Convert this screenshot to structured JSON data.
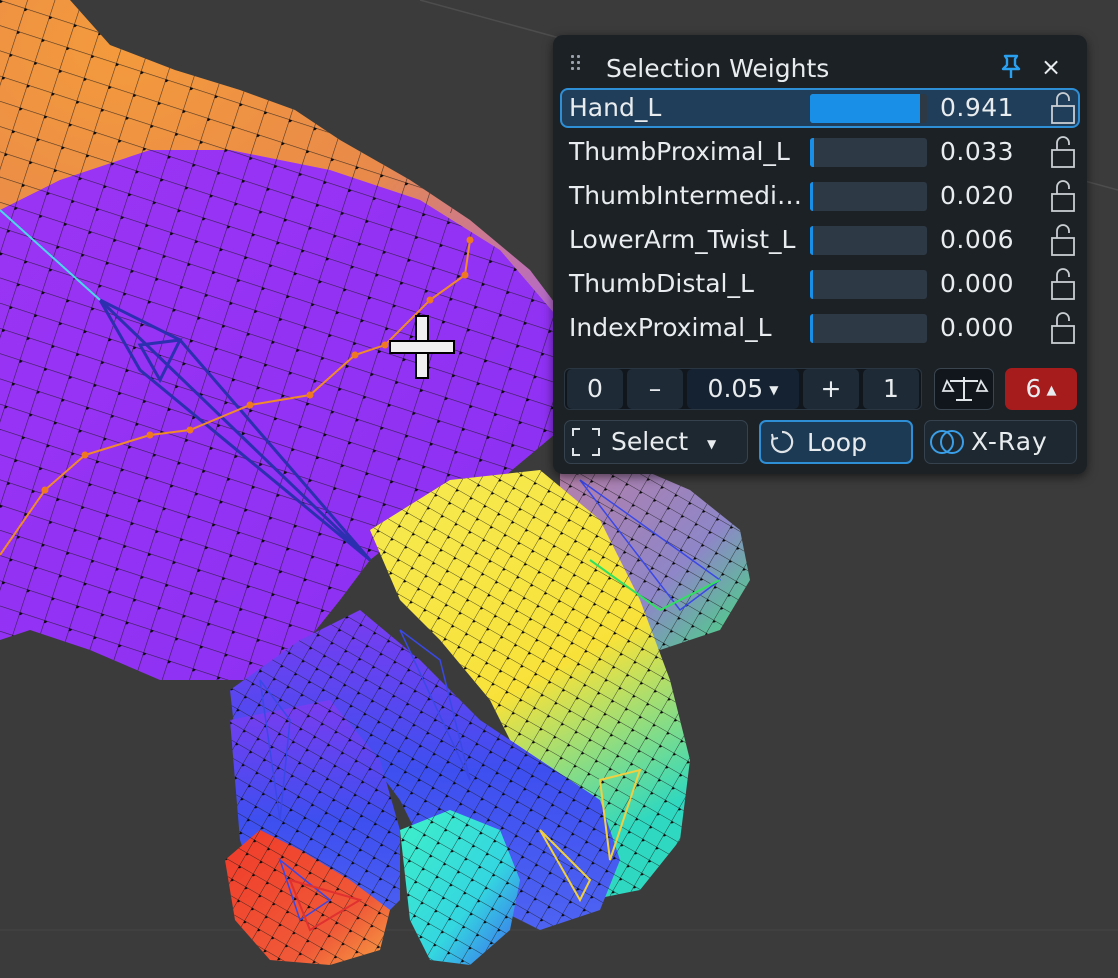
{
  "panel": {
    "title": "Selection Weights",
    "pin_icon": "pin-icon",
    "close_icon": "close-icon",
    "close_label": "×",
    "accent_color": "#1a8fe8",
    "bones": [
      {
        "name": "Hand_L",
        "value_text": "0.941",
        "weight": 0.941,
        "selected": true
      },
      {
        "name": "ThumbProximal_L",
        "value_text": "0.033",
        "weight": 0.033,
        "selected": false
      },
      {
        "name": "ThumbIntermedi…",
        "value_text": "0.020",
        "weight": 0.02,
        "selected": false
      },
      {
        "name": "LowerArm_Twist_L",
        "value_text": "0.006",
        "weight": 0.006,
        "selected": false
      },
      {
        "name": "ThumbDistal_L",
        "value_text": "0.000",
        "weight": 0.0,
        "selected": false
      },
      {
        "name": "IndexProximal_L",
        "value_text": "0.000",
        "weight": 0.0,
        "selected": false
      }
    ],
    "stepper": {
      "min_label": "0",
      "minus_label": "–",
      "step_value": "0.05",
      "plus_label": "+",
      "max_label": "1"
    },
    "normalize_icon": "balance-scale-icon",
    "count_badge": "6",
    "count_color": "#a61c1c",
    "select_mode_label": "Select",
    "loop_label": "Loop",
    "xray_label": "X-Ray"
  }
}
